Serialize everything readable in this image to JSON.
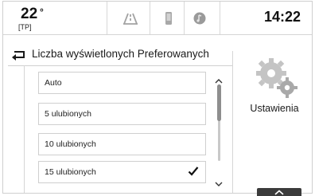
{
  "status_bar": {
    "temperature": "22",
    "temperature_unit": "°",
    "traffic_program": "[TP]",
    "clock": "14:22",
    "icons": [
      "navigation-icon",
      "phone-icon",
      "audio-source-icon"
    ]
  },
  "header": {
    "back_icon": "back-arrow-icon",
    "title": "Liczba wyświetlonych Preferowanych"
  },
  "options": [
    {
      "label": "Auto",
      "selected": false
    },
    {
      "label": "5 ulubionych",
      "selected": false
    },
    {
      "label": "10 ulubionych",
      "selected": false
    },
    {
      "label": "15 ulubionych",
      "selected": true
    }
  ],
  "scrollbar": {
    "position_fraction": 0.0,
    "visible_fraction": 0.48
  },
  "settings": {
    "icon": "gears-icon",
    "label": "Ustawienia"
  },
  "bottom_tab": {
    "icon": "chevron-up-icon"
  },
  "colors": {
    "text": "#1a1a1a",
    "border": "#cfcfcf",
    "tab": "#3b3b3b",
    "icon_grey": "#9a9a9a"
  }
}
